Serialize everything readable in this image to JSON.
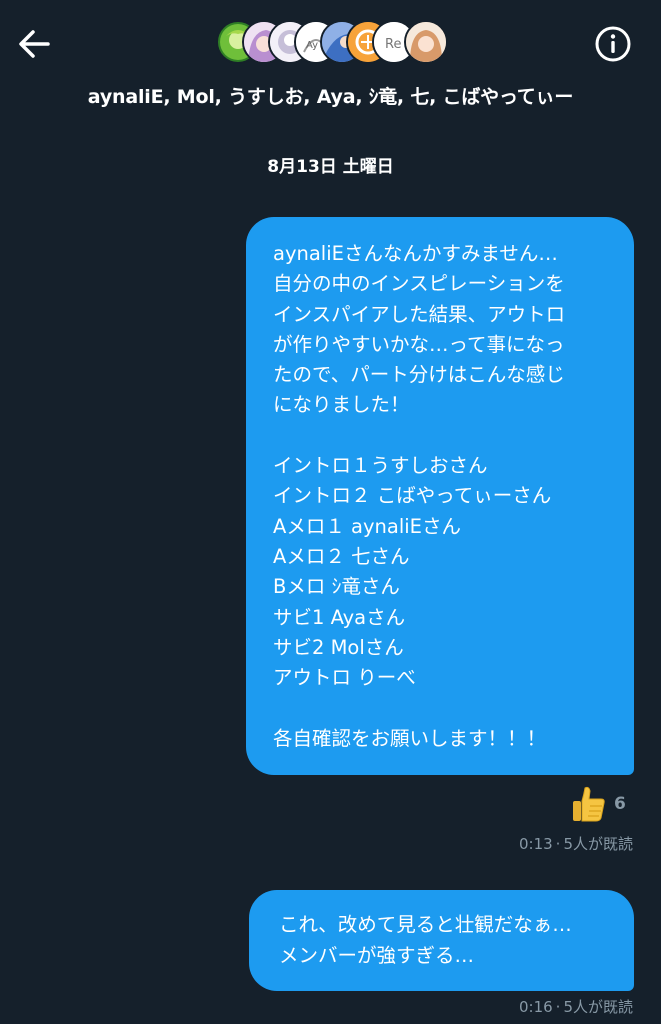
{
  "header": {
    "back_icon": "arrow-left-icon",
    "info_icon": "info-circle-icon",
    "group_title": "aynaliE, Mol, うすしお, Aya, ｼ竜, 七, こばやってぃー",
    "avatars": [
      {
        "name": "aynaliE",
        "color": "#3f8f2f"
      },
      {
        "name": "Mol",
        "color": "#c9a7d9"
      },
      {
        "name": "うすしお",
        "color": "#e8e4ef"
      },
      {
        "name": "Aya",
        "color": "#ffffff"
      },
      {
        "name": "ｼ竜",
        "color": "#5b8bd6"
      },
      {
        "name": "七",
        "color": "#f08a1c"
      },
      {
        "name": "Re",
        "color": "#ffffff"
      },
      {
        "name": "こばやってぃー",
        "color": "#e9c9a4"
      }
    ]
  },
  "date_separator": "8月13日 土曜日",
  "messages": [
    {
      "lines": [
        "aynaliEさんなんかすみません…",
        "自分の中のインスピレーションを",
        "インスパイアした結果、アウトロ",
        "が作りやすいかな…って事になっ",
        "たので、パート分けはこんな感じ",
        "になりました！",
        "",
        "イントロ１うすしおさん",
        "イントロ２ こばやってぃーさん",
        "Aメロ１ aynaliEさん",
        "Aメロ２ 七さん",
        "Bメロ ｼ竜さん",
        "サビ1 Ayaさん",
        "サビ2 Molさん",
        "アウトロ りーべ",
        "",
        "各自確認をお願いします！！！"
      ],
      "reaction": {
        "emoji": "thumbs-up-icon",
        "count": "6"
      },
      "time": "0:13",
      "read_status": "5人が既読"
    },
    {
      "lines": [
        "これ、改めて見ると壮観だなぁ…",
        "メンバーが強すぎる…"
      ],
      "time": "0:16",
      "read_status": "5人が既読"
    }
  ],
  "colors": {
    "background": "#15202b",
    "bubble": "#1d9bf0",
    "meta_text": "#8899a6"
  }
}
